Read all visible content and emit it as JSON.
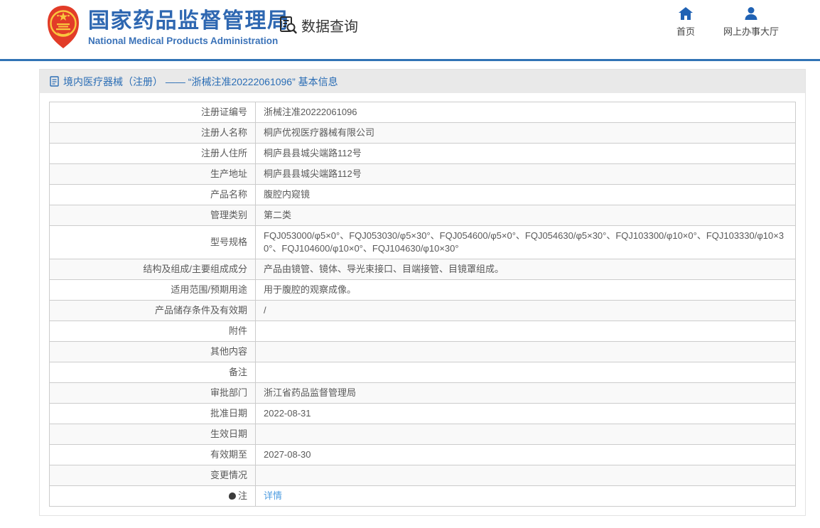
{
  "header": {
    "org_name_zh": "国家药品监督管理局",
    "org_name_en": "National Medical Products Administration",
    "nav_data_query": "数据查询",
    "nav_home": "首页",
    "nav_online_hall": "网上办事大厅"
  },
  "page": {
    "title": "境内医疗器械（注册） —— “浙械注准20222061096” 基本信息"
  },
  "table": {
    "rows": [
      {
        "label": "注册证编号",
        "value": "浙械注准20222061096"
      },
      {
        "label": "注册人名称",
        "value": "桐庐优视医疗器械有限公司"
      },
      {
        "label": "注册人住所",
        "value": "桐庐县县城尖端路112号"
      },
      {
        "label": "生产地址",
        "value": "桐庐县县城尖端路112号"
      },
      {
        "label": "产品名称",
        "value": "腹腔内窥镜"
      },
      {
        "label": "管理类别",
        "value": "第二类"
      },
      {
        "label": "型号规格",
        "value": "FQJ053000/φ5×0°、FQJ053030/φ5×30°、FQJ054600/φ5×0°、FQJ054630/φ5×30°、FQJ103300/φ10×0°、FQJ103330/φ10×30°、FQJ104600/φ10×0°、FQJ104630/φ10×30°"
      },
      {
        "label": "结构及组成/主要组成成分",
        "value": "产品由镜管、镜体、导光束接口、目端接管、目镜罩组成。"
      },
      {
        "label": "适用范围/预期用途",
        "value": "用于腹腔的观察成像。"
      },
      {
        "label": "产品储存条件及有效期",
        "value": "/"
      },
      {
        "label": "附件",
        "value": ""
      },
      {
        "label": "其他内容",
        "value": ""
      },
      {
        "label": "备注",
        "value": ""
      },
      {
        "label": "审批部门",
        "value": "浙江省药品监督管理局"
      },
      {
        "label": "批准日期",
        "value": "2022-08-31"
      },
      {
        "label": "生效日期",
        "value": ""
      },
      {
        "label": "有效期至",
        "value": "2027-08-30"
      },
      {
        "label": "变更情况",
        "value": ""
      },
      {
        "label": "注",
        "value": "详情",
        "link": true,
        "label_icon": true
      }
    ]
  },
  "colors": {
    "brand_blue": "#2e67b1",
    "header_line_blue": "#3173b5",
    "icon_blue": "#2062b4",
    "link_blue": "#4e9ce0",
    "title_strip_gray": "#e9e9e9",
    "row_alt_gray": "#f9f9f9",
    "table_border_gray": "#cccccc",
    "text_gray": "#595959",
    "emblem_red": "#e23c28",
    "emblem_gold": "#f9c73e"
  }
}
